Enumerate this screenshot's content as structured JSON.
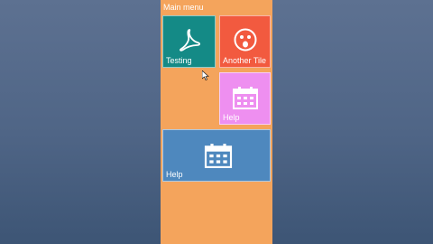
{
  "menu": {
    "title": "Main menu"
  },
  "tiles": [
    {
      "label": "Testing",
      "icon": "acrobat-icon",
      "color": "#148a86"
    },
    {
      "label": "Another Tile",
      "icon": "surprised-face-icon",
      "color": "#f25a3f"
    },
    {
      "label": "Help",
      "icon": "calendar-icon",
      "color": "#ee8ff0"
    },
    {
      "label": "Help",
      "icon": "calendar-icon",
      "color": "#4e88be"
    }
  ],
  "colors": {
    "panel": "#f4a45c",
    "background": "#55698a"
  }
}
